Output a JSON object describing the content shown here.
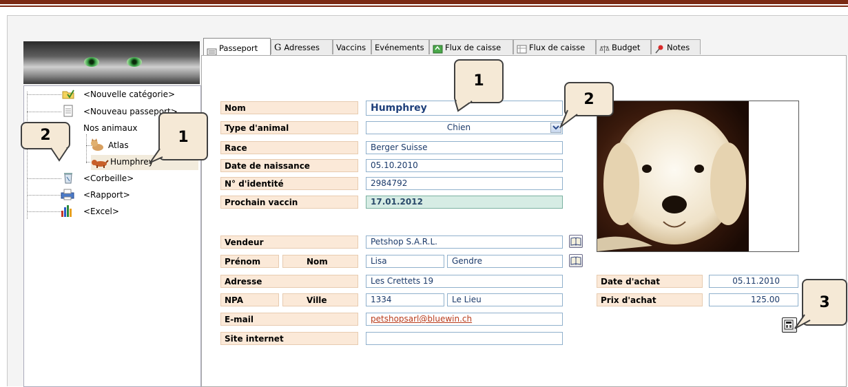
{
  "tabs": [
    {
      "label": "Passeport",
      "icon": "passport-icon"
    },
    {
      "label": "Adresses",
      "icon": "g-letter-icon",
      "prefix": "G"
    },
    {
      "label": "Vaccins",
      "icon": ""
    },
    {
      "label": "Evénements",
      "icon": ""
    },
    {
      "label": "Flux de caisse",
      "icon": "cash-flow-icon"
    },
    {
      "label": "Flux de caisse",
      "icon": "ledger-icon"
    },
    {
      "label": "Budget",
      "icon": "scale-icon"
    },
    {
      "label": "Notes",
      "icon": "pin-icon"
    }
  ],
  "tree": {
    "items": [
      {
        "label": "<Nouvelle catégorie>",
        "icon": "folder-check-icon"
      },
      {
        "label": "<Nouveau passeport>",
        "icon": "document-icon"
      },
      {
        "label": "Nos animaux",
        "icon": ""
      },
      {
        "label": "Atlas",
        "icon": "cat-icon"
      },
      {
        "label": "Humphrey",
        "icon": "dog-icon"
      },
      {
        "label": "<Corbeille>",
        "icon": "trash-icon"
      },
      {
        "label": "<Rapport>",
        "icon": "printer-icon"
      },
      {
        "label": "<Excel>",
        "icon": "excel-chart-icon"
      }
    ]
  },
  "form": {
    "nom_label": "Nom",
    "nom_value": "Humphrey",
    "type_label": "Type d'animal",
    "type_value": "Chien",
    "race_label": "Race",
    "race_value": "Berger Suisse",
    "naissance_label": "Date de naissance",
    "naissance_value": "05.10.2010",
    "identite_label": "N° d'identité",
    "identite_value": "2984792",
    "vaccin_label": "Prochain vaccin",
    "vaccin_value": "17.01.2012",
    "vendeur_label": "Vendeur",
    "vendeur_value": "Petshop S.A.R.L.",
    "prenom_label": "Prénom",
    "nom2_label": "Nom",
    "prenom_value": "Lisa",
    "nom2_value": "Gendre",
    "adresse_label": "Adresse",
    "adresse_value": "Les Crettets 19",
    "npa_label": "NPA",
    "ville_label": "Ville",
    "npa_value": "1334",
    "ville_value": "Le Lieu",
    "email_label": "E-mail",
    "email_value": "petshopsarl@bluewin.ch",
    "site_label": "Site internet",
    "site_value": "",
    "date_achat_label": "Date d'achat",
    "date_achat_value": "05.11.2010",
    "prix_achat_label": "Prix d'achat",
    "prix_achat_value": "125.00"
  },
  "callouts": {
    "c1_tree": "1",
    "c2_tree": "2",
    "c1_form": "1",
    "c2_form": "2",
    "c3_form": "3"
  },
  "colors": {
    "accent_bar": "#7b2a14",
    "label_bg": "#fbe9d8",
    "field_border": "#8fb0cc",
    "vaccine_bg": "#d6ece4",
    "callout_bg": "#f5e9d6"
  }
}
